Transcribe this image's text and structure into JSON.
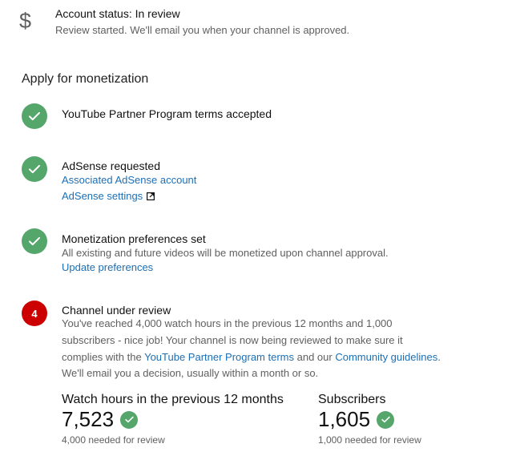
{
  "account_status": {
    "icon": "dollar-icon",
    "title": "Account status: In review",
    "subtitle": "Review started. We'll email you when your channel is approved."
  },
  "section_title": "Apply for monetization",
  "steps": [
    {
      "state": "done",
      "icon": "check-icon",
      "title": "YouTube Partner Program terms accepted"
    },
    {
      "state": "done",
      "icon": "check-icon",
      "title": "AdSense requested",
      "links": [
        "Associated AdSense account",
        "AdSense settings"
      ]
    },
    {
      "state": "done",
      "icon": "check-icon",
      "title": "Monetization preferences set",
      "text": "All existing and future videos will be monetized upon channel approval.",
      "link": "Update preferences"
    },
    {
      "state": "pending",
      "number": "4",
      "title": "Channel under review",
      "lines": [
        "You've reached 4,000 watch hours in the previous 12 months and 1,000",
        "subscribers - nice job! Your channel is now being reviewed to make sure it"
      ],
      "line3_prefix": "complies with the ",
      "line3_link1": "YouTube Partner Program terms",
      "line3_mid": " and our ",
      "line3_link2": "Community guidelines",
      "line3_suffix": ".",
      "line4": "We'll email you a decision, usually within a month or so."
    }
  ],
  "stats": {
    "watch_hours": {
      "label": "Watch hours in the previous 12 months",
      "value": "7,523",
      "requirement": "4,000 needed for review"
    },
    "subscribers": {
      "label": "Subscribers",
      "value": "1,605",
      "requirement": "1,000 needed for review"
    }
  },
  "colors": {
    "success": "#54a66a",
    "alert": "#cc0000",
    "link": "#1c6fb5"
  }
}
